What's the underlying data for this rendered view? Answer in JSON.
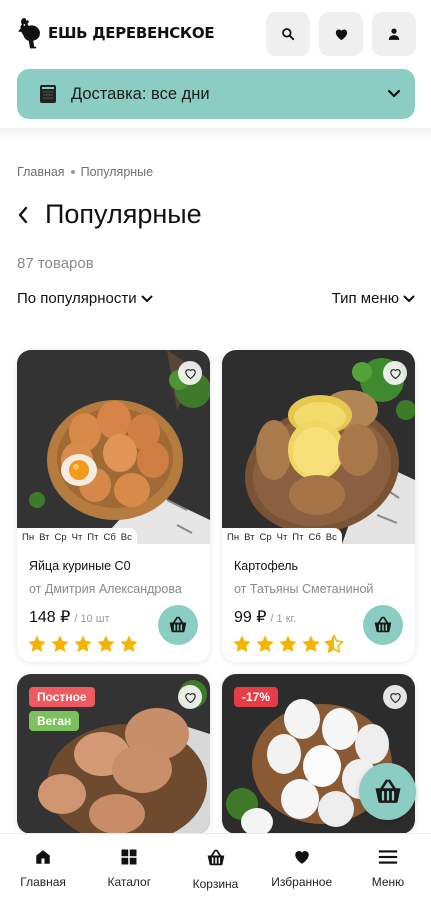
{
  "header": {
    "logo_text": "Ешь деревенское",
    "actions": [
      "search-icon",
      "heart-icon",
      "user-icon"
    ]
  },
  "delivery": {
    "label": "Доставка: все дни",
    "icon": "calendar-icon"
  },
  "breadcrumb": {
    "items": [
      "Главная",
      "Популярные"
    ]
  },
  "page": {
    "title": "Популярные",
    "count": "87 товаров",
    "sort_label": "По популярности",
    "menu_type_label": "Тип меню"
  },
  "products": [
    {
      "days": [
        "Пн",
        "Вт",
        "Ср",
        "Чт",
        "Пт",
        "Сб",
        "Вс"
      ],
      "name": "Яйца куриные С0",
      "seller": "от Дмитрия Александрова",
      "price": "148 ₽",
      "unit": "/ 10 шт",
      "rating": 5
    },
    {
      "days": [
        "Пн",
        "Вт",
        "Ср",
        "Чт",
        "Пт",
        "Сб",
        "Вс"
      ],
      "name": "Картофель",
      "seller": "от Татьяны Сметаниной",
      "price": "99 ₽",
      "unit": "/ 1 кг.",
      "rating": 4.5
    },
    {
      "tags": [
        "Постное",
        "Веган"
      ]
    },
    {
      "tags": [
        "-17%"
      ]
    }
  ],
  "bottom_nav": [
    {
      "label": "Главная",
      "icon": "home-icon"
    },
    {
      "label": "Каталог",
      "icon": "grid-icon"
    },
    {
      "label": "Корзина",
      "icon": "basket-icon"
    },
    {
      "label": "Избранное",
      "icon": "heart-icon"
    },
    {
      "label": "Меню",
      "icon": "menu-icon"
    }
  ],
  "colors": {
    "accent": "#8ccdc3",
    "star": "#f5b400",
    "tag_fast": "#ee5a5f",
    "tag_vegan": "#7cc25c",
    "tag_sale": "#e63d46"
  }
}
